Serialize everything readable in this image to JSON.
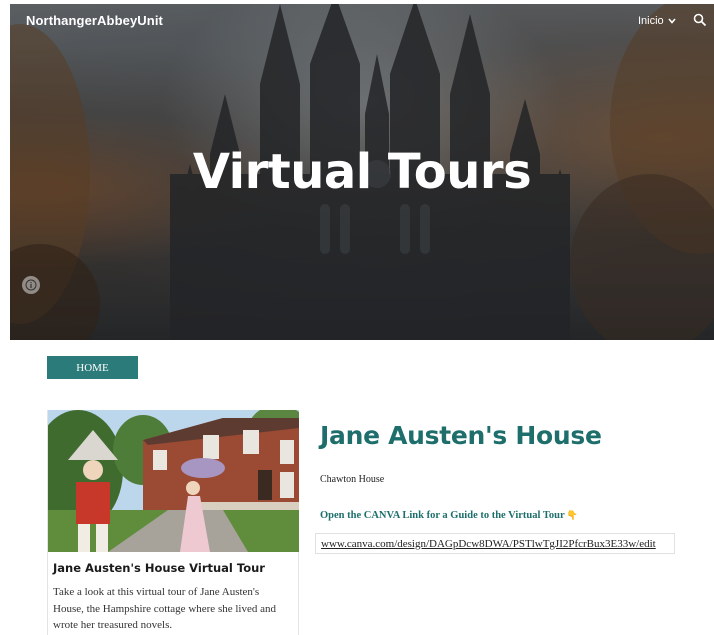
{
  "header": {
    "site_title": "NorthangerAbbeyUnit",
    "nav_item": "Inicio",
    "nav_chevron_icon": "chevron-down-icon",
    "search_icon": "search-icon"
  },
  "hero": {
    "title": "Virtual Tours",
    "info_icon": "info-icon"
  },
  "home_button": {
    "label": "HOME"
  },
  "card": {
    "title": "Jane Austen's House Virtual Tour",
    "description": "Take a look at this virtual tour of Jane Austen's House, the Hampshire cottage where she lived and wrote her treasured novels."
  },
  "main": {
    "heading": "Jane Austen's House",
    "subtitle": "Chawton House",
    "canva_label": "Open the CANVA Link for a Guide to the Virtual Tour",
    "canva_emoji": "👇",
    "link": "www.canva.com/design/DAGpDcw8DWA/PSTlwTgJI2PfcrBux3E33w/edit"
  },
  "colors": {
    "accent": "#2a7b79",
    "heading": "#1e6f6c"
  }
}
